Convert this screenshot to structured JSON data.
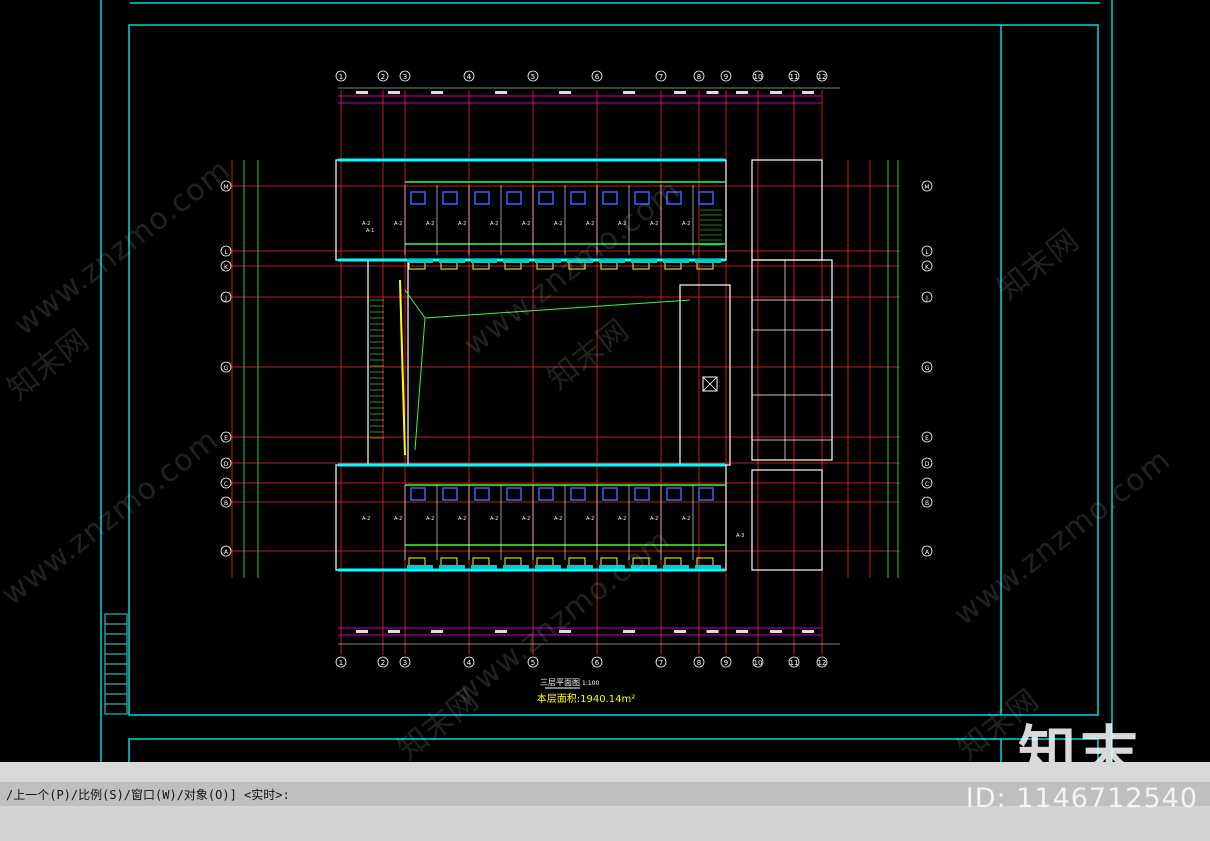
{
  "command_line": {
    "prompt": "/上一个(P)/比例(S)/窗口(W)/对象(O)] <实时>:"
  },
  "drawing": {
    "plan_title": "三层平面图",
    "plan_scale": "1:100",
    "area_label": "本层面积:1940.14m²",
    "grid_columns": [
      "①",
      "②",
      "③",
      "④",
      "⑤",
      "⑥",
      "⑦",
      "⑧",
      "⑨",
      "⑩",
      "⑪",
      "⑫"
    ],
    "grid_columns_top": [
      "①",
      "②",
      "③",
      "④",
      "⑤",
      "⑥",
      "⑦",
      "⑧",
      "⑨",
      "⑩",
      "⑪",
      "⑫"
    ],
    "grid_rows": [
      "M",
      "L",
      "K",
      "J",
      "G",
      "E",
      "D",
      "C",
      "B",
      "A"
    ],
    "room_label": "A-2",
    "room_label_alt": "A-1",
    "room_label_b": "A-3"
  },
  "watermarks": {
    "site_url": "www.znzmo.com",
    "site_name": "知末网",
    "brand": "知末",
    "image_id": "ID: 1146712540"
  },
  "colors": {
    "background": "#000000",
    "frame": "#00e5e5",
    "walls": "#ffffff",
    "grid": "#ff2020",
    "dims": "#ff00ff",
    "green": "#33ff33",
    "yellow": "#ffff00",
    "blue": "#3366ff"
  }
}
